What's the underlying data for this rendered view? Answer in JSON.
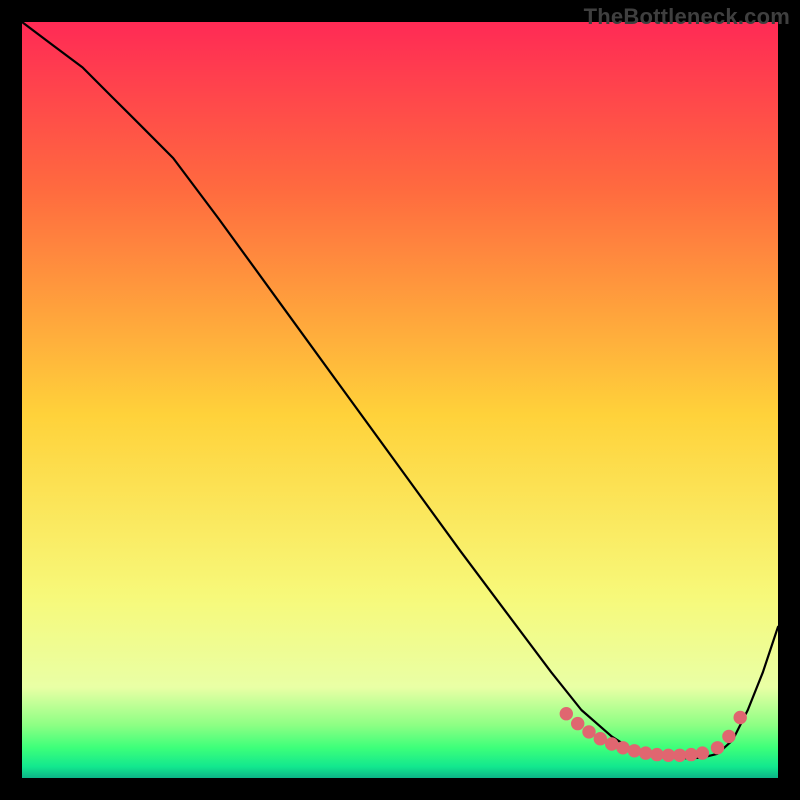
{
  "watermark": "TheBottleneck.com",
  "chart_data": {
    "type": "line",
    "title": "",
    "xlabel": "",
    "ylabel": "",
    "xlim": [
      0,
      100
    ],
    "ylim": [
      0,
      100
    ],
    "grid": false,
    "legend": false,
    "series": [
      {
        "name": "curve",
        "x": [
          0,
          4,
          8,
          12,
          16,
          20,
          26,
          34,
          42,
          50,
          58,
          64,
          70,
          74,
          78,
          80,
          82,
          84,
          86,
          88,
          90,
          92,
          94,
          96,
          98,
          100
        ],
        "y": [
          100,
          97,
          94,
          90,
          86,
          82,
          74,
          63,
          52,
          41,
          30,
          22,
          14,
          9,
          5.5,
          4.2,
          3.4,
          2.9,
          2.7,
          2.6,
          2.7,
          3.2,
          5,
          9,
          14,
          20
        ]
      }
    ],
    "highlight_dots": {
      "name": "highlight",
      "points_x": [
        72,
        73.5,
        75,
        76.5,
        78,
        79.5,
        81,
        82.5,
        84,
        85.5,
        87,
        88.5,
        90,
        92,
        93.5,
        95
      ],
      "points_y": [
        8.5,
        7.2,
        6.1,
        5.2,
        4.5,
        4.0,
        3.6,
        3.3,
        3.1,
        3.0,
        3.0,
        3.1,
        3.3,
        4.0,
        5.5,
        8.0
      ]
    },
    "gradient_colors": {
      "top": "#ff2a55",
      "upper": "#ff6a3f",
      "mid": "#ffd23a",
      "lower": "#f7f97a",
      "palelow": "#e9ffa5",
      "green1": "#8dff84",
      "green2": "#3dff7a",
      "green3": "#12e88e",
      "bottom": "#0cb487"
    }
  }
}
